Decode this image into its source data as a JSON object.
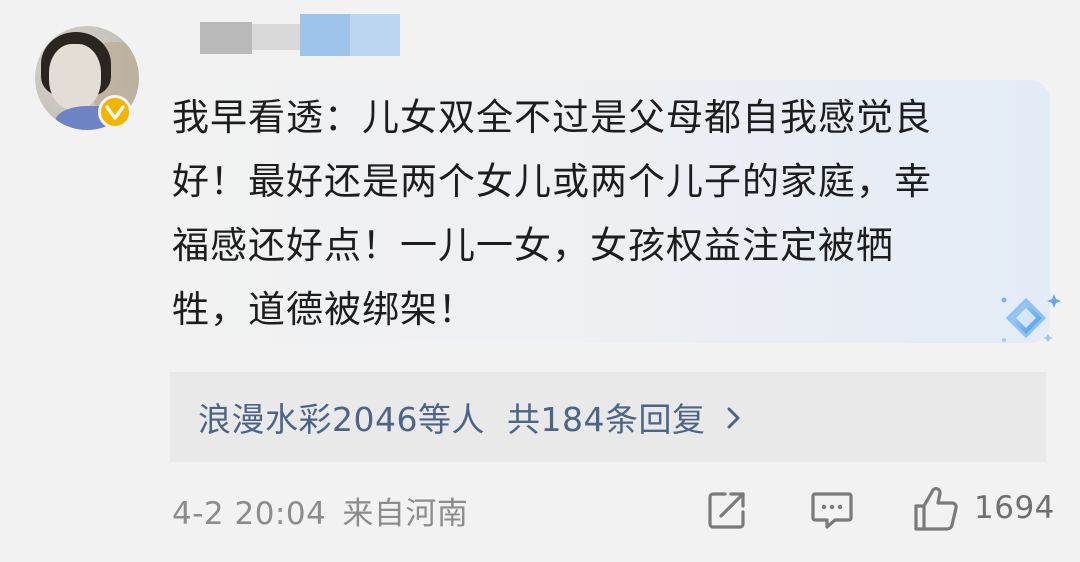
{
  "comment": {
    "text": "我早看透：儿女双全不过是父母都自我感觉良\n好！最好还是两个女儿或两个儿子的家庭，幸\n福感还好点！一儿一女，女孩权益注定被牺\n牲，道德被绑架！"
  },
  "replies": {
    "repliers": "浪漫水彩2046等人",
    "count": "共184条回复"
  },
  "footer": {
    "timestamp": "4-2 20:04",
    "location": "来自河南",
    "like_count": "1694"
  },
  "icons": {
    "verified": "verified-badge-icon",
    "share": "share-icon",
    "comment": "comment-icon",
    "like": "like-icon",
    "chevron": "chevron-right-icon",
    "sparkle": "sparkle-icon"
  },
  "colors": {
    "verified_badge": "#f4b400",
    "link_text": "#4c6587",
    "meta_text": "#8c8c8c",
    "reply_box_bg": "#e9e9e9",
    "page_bg": "#f2f2f2"
  }
}
